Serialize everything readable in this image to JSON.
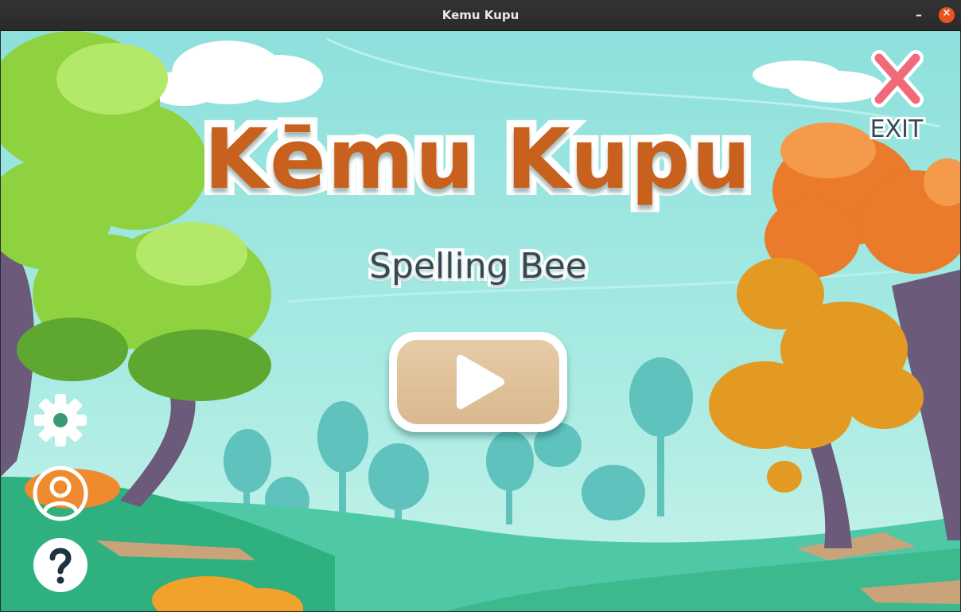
{
  "window": {
    "title": "Kemu Kupu",
    "minimize_glyph": "–",
    "close_glyph": "×"
  },
  "game": {
    "title": "Kēmu Kupu",
    "subtitle": "Spelling Bee"
  },
  "buttons": {
    "play_icon": "play-icon",
    "exit_label": "EXIT",
    "exit_icon": "x-icon",
    "settings_icon": "gear-icon",
    "profile_icon": "user-icon",
    "help_icon": "question-icon"
  },
  "colors": {
    "sky": "#7fdad6",
    "title": "#c8611e",
    "subtitle": "#334a55",
    "play_button": "#ddbd94",
    "exit_x": "#f06a7a",
    "close_button": "#e95420"
  }
}
